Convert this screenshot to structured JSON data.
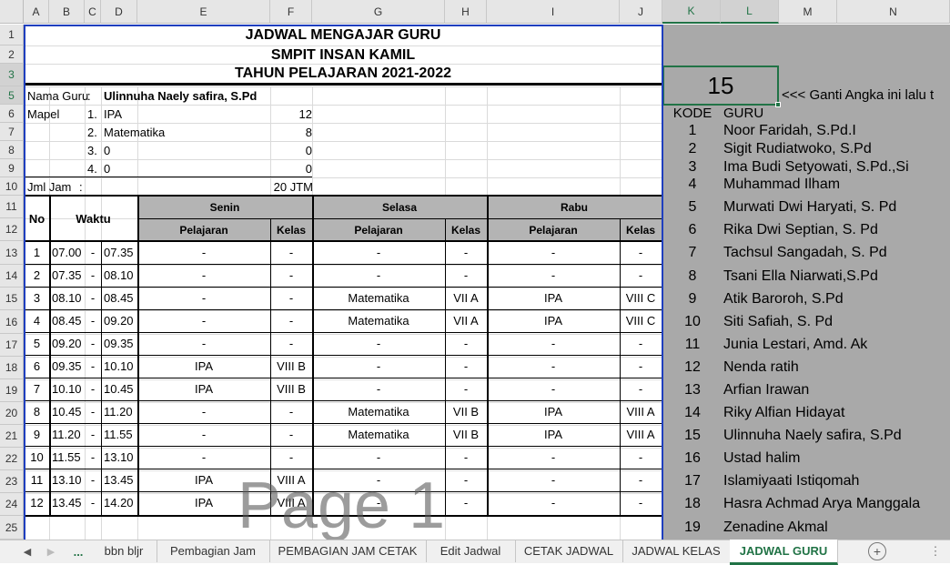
{
  "columns": [
    "A",
    "B",
    "C",
    "D",
    "E",
    "F",
    "G",
    "H",
    "I",
    "J",
    "K",
    "L",
    "M",
    "N"
  ],
  "rows": [
    "1",
    "2",
    "3",
    "5",
    "6",
    "7",
    "8",
    "9",
    "10",
    "11",
    "12",
    "13",
    "14",
    "15",
    "16",
    "17",
    "18",
    "19",
    "20",
    "21",
    "22",
    "23",
    "24",
    "25"
  ],
  "title": {
    "line1": "JADWAL MENGAJAR GURU",
    "line2": "SMPIT INSAN KAMIL",
    "line3": "TAHUN PELAJARAN 2021-2022"
  },
  "info": {
    "nama_label": "Nama Guru",
    "colon": ":",
    "nama_value": "Ulinnuha Naely safira, S.Pd",
    "mapel_label": "Mapel",
    "mapel": [
      {
        "no": "1.",
        "name": "IPA",
        "jam": "12"
      },
      {
        "no": "2.",
        "name": "Matematika",
        "jam": "8"
      },
      {
        "no": "3.",
        "name": "0",
        "jam": "0"
      },
      {
        "no": "4.",
        "name": "0",
        "jam": "0"
      }
    ],
    "jml_label": "Jml Jam",
    "jml_colon": ":",
    "jml_value": "20 JTM"
  },
  "table_head": {
    "no": "No",
    "waktu": "Waktu",
    "days": [
      "Senin",
      "Selasa",
      "Rabu"
    ],
    "pelajaran": "Pelajaran",
    "kelas": "Kelas"
  },
  "schedule": [
    {
      "no": "1",
      "start": "07.00",
      "dash": "-",
      "end": "07.35",
      "sp": "-",
      "sk": "-",
      "tp": "-",
      "tk": "-",
      "rp": "-",
      "rk": "-"
    },
    {
      "no": "2",
      "start": "07.35",
      "dash": "-",
      "end": "08.10",
      "sp": "-",
      "sk": "-",
      "tp": "-",
      "tk": "-",
      "rp": "-",
      "rk": "-"
    },
    {
      "no": "3",
      "start": "08.10",
      "dash": "-",
      "end": "08.45",
      "sp": "-",
      "sk": "-",
      "tp": "Matematika",
      "tk": "VII A",
      "rp": "IPA",
      "rk": "VIII C"
    },
    {
      "no": "4",
      "start": "08.45",
      "dash": "-",
      "end": "09.20",
      "sp": "-",
      "sk": "-",
      "tp": "Matematika",
      "tk": "VII A",
      "rp": "IPA",
      "rk": "VIII C"
    },
    {
      "no": "5",
      "start": "09.20",
      "dash": "-",
      "end": "09.35",
      "sp": "-",
      "sk": "-",
      "tp": "-",
      "tk": "-",
      "rp": "-",
      "rk": "-"
    },
    {
      "no": "6",
      "start": "09.35",
      "dash": "-",
      "end": "10.10",
      "sp": "IPA",
      "sk": "VIII B",
      "tp": "-",
      "tk": "-",
      "rp": "-",
      "rk": "-"
    },
    {
      "no": "7",
      "start": "10.10",
      "dash": "-",
      "end": "10.45",
      "sp": "IPA",
      "sk": "VIII B",
      "tp": "-",
      "tk": "-",
      "rp": "-",
      "rk": "-"
    },
    {
      "no": "8",
      "start": "10.45",
      "dash": "-",
      "end": "11.20",
      "sp": "-",
      "sk": "-",
      "tp": "Matematika",
      "tk": "VII B",
      "rp": "IPA",
      "rk": "VIII A"
    },
    {
      "no": "9",
      "start": "11.20",
      "dash": "-",
      "end": "11.55",
      "sp": "-",
      "sk": "-",
      "tp": "Matematika",
      "tk": "VII B",
      "rp": "IPA",
      "rk": "VIII A"
    },
    {
      "no": "10",
      "start": "11.55",
      "dash": "-",
      "end": "13.10",
      "sp": "-",
      "sk": "-",
      "tp": "-",
      "tk": "-",
      "rp": "-",
      "rk": "-"
    },
    {
      "no": "11",
      "start": "13.10",
      "dash": "-",
      "end": "13.45",
      "sp": "IPA",
      "sk": "VIII A",
      "tp": "-",
      "tk": "-",
      "rp": "-",
      "rk": "-"
    },
    {
      "no": "12",
      "start": "13.45",
      "dash": "-",
      "end": "14.20",
      "sp": "IPA",
      "sk": "VIII A",
      "tp": "-",
      "tk": "-",
      "rp": "-",
      "rk": "-"
    }
  ],
  "selector": {
    "value": "15",
    "hint": "<<< Ganti Angka ini lalu t"
  },
  "guru_head": {
    "kode": "KODE",
    "guru": "GURU"
  },
  "guru_list": [
    {
      "kode": "1",
      "nama": "Noor Faridah, S.Pd.I"
    },
    {
      "kode": "2",
      "nama": "Sigit Rudiatwoko, S.Pd"
    },
    {
      "kode": "3",
      "nama": "Ima Budi Setyowati, S.Pd.,Si"
    },
    {
      "kode": "4",
      "nama": "Muhammad Ilham"
    },
    {
      "kode": "5",
      "nama": "Murwati Dwi Haryati, S. Pd"
    },
    {
      "kode": "6",
      "nama": "Rika Dwi Septian, S. Pd"
    },
    {
      "kode": "7",
      "nama": "Tachsul Sangadah, S. Pd"
    },
    {
      "kode": "8",
      "nama": "Tsani Ella Niarwati,S.Pd"
    },
    {
      "kode": "9",
      "nama": "Atik Baroroh, S.Pd"
    },
    {
      "kode": "10",
      "nama": "Siti Safiah, S. Pd"
    },
    {
      "kode": "11",
      "nama": "Junia Lestari, Amd. Ak"
    },
    {
      "kode": "12",
      "nama": "Nenda ratih"
    },
    {
      "kode": "13",
      "nama": "Arfian Irawan"
    },
    {
      "kode": "14",
      "nama": "Riky Alfian Hidayat"
    },
    {
      "kode": "15",
      "nama": "Ulinnuha Naely safira, S.Pd"
    },
    {
      "kode": "16",
      "nama": "Ustad halim"
    },
    {
      "kode": "17",
      "nama": "Islamiyaati Istiqomah"
    },
    {
      "kode": "18",
      "nama": "Hasra Achmad Arya Manggala"
    },
    {
      "kode": "19",
      "nama": "Zenadine Akmal"
    }
  ],
  "watermark": "Page 1",
  "tabs": {
    "ellipsis": "...",
    "items": [
      "bbn bljr",
      "Pembagian Jam",
      "PEMBAGIAN JAM CETAK",
      "Edit Jadwal",
      "CETAK JADWAL",
      "JADWAL KELAS",
      "JADWAL GURU"
    ],
    "add": "+",
    "more": "⋮"
  },
  "colors": {
    "accent": "#217346",
    "gray_panel": "#a9a9a9",
    "header_fill": "#b4b4b4",
    "page_border": "#1f3fbf"
  }
}
